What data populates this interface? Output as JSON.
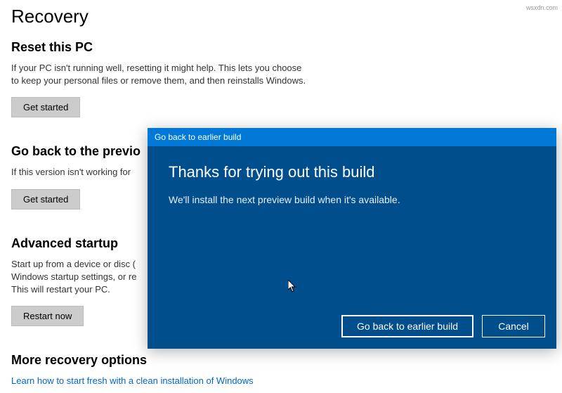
{
  "page": {
    "title": "Recovery",
    "reset": {
      "heading": "Reset this PC",
      "body": "If your PC isn't running well, resetting it might help. This lets you choose to keep your personal files or remove them, and then reinstalls Windows.",
      "button": "Get started"
    },
    "goback": {
      "heading": "Go back to the previo",
      "body": "If this version isn't working for",
      "button": "Get started"
    },
    "advanced": {
      "heading": "Advanced startup",
      "body": "Start up from a device or disc (\nWindows startup settings, or re\nThis will restart your PC.",
      "button": "Restart now"
    },
    "more": {
      "heading": "More recovery options",
      "link": "Learn how to start fresh with a clean installation of Windows"
    }
  },
  "dialog": {
    "title": "Go back to earlier build",
    "heading": "Thanks for trying out this build",
    "body": "We'll install the next preview build when it's available.",
    "primary_button": "Go back to earlier build",
    "cancel_button": "Cancel"
  },
  "watermark": "wsxdn.com"
}
